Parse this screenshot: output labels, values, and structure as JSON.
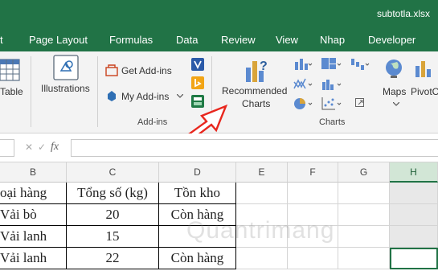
{
  "titlebar": {
    "filename": "subtotla.xlsx"
  },
  "tabs": [
    "t",
    "Page Layout",
    "Formulas",
    "Data",
    "Review",
    "View",
    "Nhap",
    "Developer"
  ],
  "ribbon": {
    "table_label": "Table",
    "illustrations_label": "Illustrations",
    "get_addins_label": "Get Add-ins",
    "my_addins_label": "My Add-ins",
    "addins_group_label": "Add-ins",
    "recommended_label_1": "Recommended",
    "recommended_label_2": "Charts",
    "maps_label": "Maps",
    "pivotchart_label": "PivotC",
    "charts_group_label": "Charts"
  },
  "formula_bar": {
    "fx_label": "fx",
    "cancel": "✕",
    "confirm": "✓"
  },
  "columns": [
    "B",
    "C",
    "D",
    "E",
    "F",
    "G",
    "H"
  ],
  "rows": [
    [
      "oại hàng",
      "Tổng số (kg)",
      "Tồn kho"
    ],
    [
      "Vải bò",
      "20",
      "Còn hàng"
    ],
    [
      "Vải lanh",
      "15",
      ""
    ],
    [
      "Vải lanh",
      "22",
      "Còn hàng"
    ]
  ],
  "watermark": "Quantrimang",
  "colors": {
    "accent": "#217346",
    "arrow": "#e8271e"
  }
}
